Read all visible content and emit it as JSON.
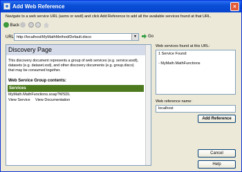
{
  "window": {
    "title": "Add Web Reference"
  },
  "instructions": "Navigate to a web service URL (asmx or wsdl) and click Add Reference to add all the available services found at that URL.",
  "toolbar": {
    "back_label": "Back"
  },
  "url": {
    "label": "URL:",
    "value": "http://localhost/MyMathMethod/Default.disco",
    "go_label": "Go"
  },
  "browser": {
    "page_title": "Discovery Page",
    "description": [
      "This discovery document represents a group of web services (e.g. service.wsdl),",
      "datasets (e.g. dataset.xsd), and other discovery documents (e.g. group.disco)",
      "that may be consumed together."
    ],
    "group_heading": "Web Service Group contents:",
    "services_header": "Services",
    "service_path": "MyMath.MathFunctions.soap?WSDL",
    "view_service": "View Service",
    "view_documentation": "View Documentation"
  },
  "found": {
    "label": "Web services found at this URL:",
    "count_text": "1 Service Found:",
    "items": [
      "- MyMath.MathFunctions"
    ]
  },
  "reference": {
    "label": "Web reference name:",
    "value": "localhost"
  },
  "buttons": {
    "add_reference": "Add Reference",
    "cancel": "Cancel",
    "help": "Help"
  }
}
